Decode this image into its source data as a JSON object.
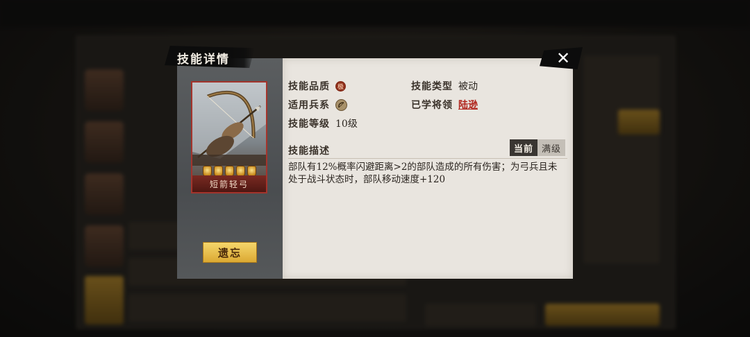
{
  "modal": {
    "title": "技能详情",
    "close_label": "✕",
    "card": {
      "name": "短箭轻弓",
      "stars": 5
    },
    "forget_button": "遗忘",
    "attributes": {
      "quality_label": "技能品质",
      "quality_icon_text": "极",
      "type_label": "技能类型",
      "type_value": "被动",
      "troop_label": "适用兵系",
      "learned_label": "已学将领",
      "learned_value": "陆逊",
      "level_label": "技能等级",
      "level_value": "10级"
    },
    "description": {
      "title": "技能描述",
      "tab_current": "当前",
      "tab_max": "满级",
      "text": "部队有12%概率闪避距离>2的部队造成的所有伤害；为弓兵且未处于战斗状态时，部队移动速度+120"
    }
  },
  "icons": {
    "close": "close-icon",
    "quality": "quality-badge-icon",
    "troop": "bow-icon"
  }
}
